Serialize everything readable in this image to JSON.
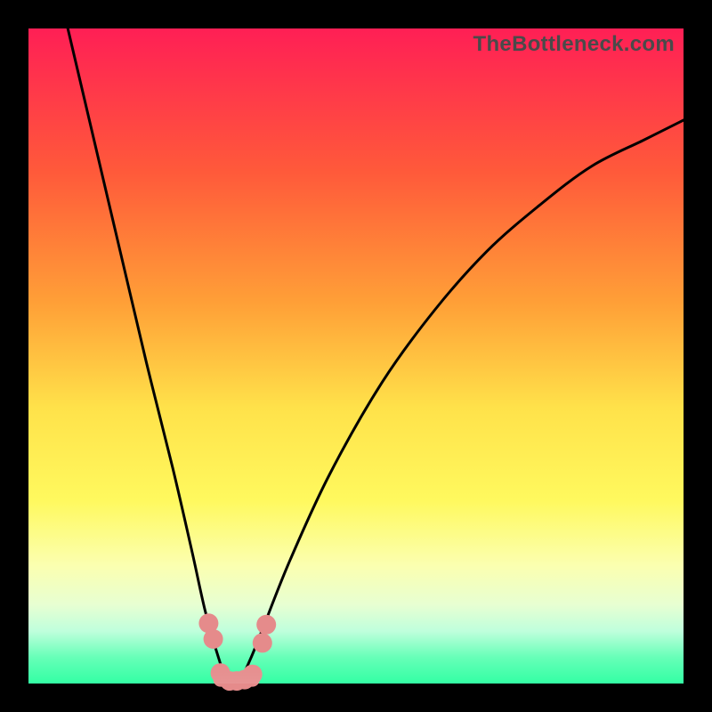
{
  "watermark": "TheBottleneck.com",
  "chart_data": {
    "type": "line",
    "title": "",
    "xlabel": "",
    "ylabel": "",
    "xlim": [
      0,
      100
    ],
    "ylim": [
      0,
      100
    ],
    "grid": false,
    "legend": false,
    "annotations": [],
    "series": [
      {
        "name": "bottleneck-curve",
        "color": "#000000",
        "x": [
          6,
          10,
          14,
          18,
          22,
          25,
          27,
          29,
          30.5,
          32,
          34,
          36,
          40,
          46,
          54,
          62,
          70,
          78,
          86,
          94,
          100
        ],
        "values": [
          100,
          83,
          66,
          49,
          33,
          20,
          11,
          4,
          0,
          0,
          4,
          9,
          19,
          32,
          46,
          57,
          66,
          73,
          79,
          83,
          86
        ]
      },
      {
        "name": "markers",
        "color": "#e58b8b",
        "x": [
          27.5,
          28.2,
          29.3,
          30.7,
          31.8,
          33.0,
          34.2,
          35.7,
          36.3
        ],
        "values": [
          9.2,
          6.8,
          1.6,
          0.4,
          0.4,
          0.6,
          1.4,
          6.2,
          9.0
        ]
      }
    ],
    "background_gradient": {
      "top": "#ff1f55",
      "bottom": "#23ff9d"
    }
  }
}
